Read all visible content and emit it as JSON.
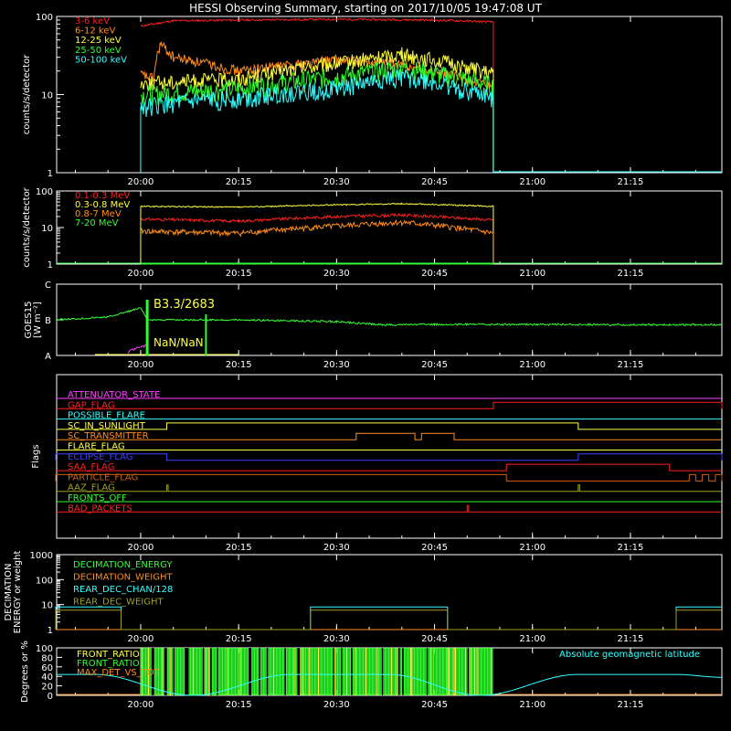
{
  "title": "HESSI Observing Summary, starting on 2017/10/05 19:47:08 UT",
  "time_ticks": [
    "20:00",
    "20:15",
    "20:30",
    "20:45",
    "21:00",
    "21:15"
  ],
  "colors": {
    "red": "#ff2020",
    "orange": "#ff8c1a",
    "yellow": "#ffff40",
    "green": "#30ff30",
    "cyan": "#30ffff",
    "magenta": "#ff40ff",
    "blue": "#4040ff",
    "brown": "#d06010",
    "olive": "#a0a020",
    "white": "#ffffff"
  },
  "chart_data": [
    {
      "type": "line",
      "panel": "lightcurve-front",
      "ylabel": "counts/s/detector",
      "yscale": "log",
      "ylim": [
        1,
        100
      ],
      "y_ticks": [
        "1",
        "10",
        "100"
      ],
      "xlim": [
        "19:47:08",
        "21:29:00"
      ],
      "legend_placement": "top-left",
      "series": [
        {
          "name": "3-6 keV",
          "color": "red",
          "x": [
            "20:00",
            "20:05",
            "20:15",
            "20:30",
            "20:45",
            "20:54",
            "20:54"
          ],
          "y": [
            75,
            88,
            90,
            92,
            90,
            85,
            1
          ]
        },
        {
          "name": "6-12 keV",
          "color": "orange",
          "x": [
            "20:00",
            "20:02",
            "20:03",
            "20:05",
            "20:15",
            "20:30",
            "20:40",
            "20:54",
            "20:54"
          ],
          "y": [
            18,
            16,
            44,
            30,
            20,
            28,
            24,
            12,
            1
          ]
        },
        {
          "name": "12-25 keV",
          "color": "yellow",
          "x": [
            "20:00",
            "20:15",
            "20:30",
            "20:40",
            "20:54",
            "20:54"
          ],
          "y": [
            14,
            16,
            25,
            33,
            18,
            1
          ]
        },
        {
          "name": "25-50 keV",
          "color": "green",
          "x": [
            "20:00",
            "20:15",
            "20:30",
            "20:40",
            "20:54",
            "20:54"
          ],
          "y": [
            10,
            12,
            17,
            22,
            13,
            1
          ]
        },
        {
          "name": "50-100 keV",
          "color": "cyan",
          "x": [
            "20:00",
            "20:15",
            "20:30",
            "20:40",
            "20:54",
            "20:54"
          ],
          "y": [
            7,
            9,
            12,
            17,
            9,
            1
          ]
        }
      ]
    },
    {
      "type": "line",
      "panel": "lightcurve-rear",
      "ylabel": "counts/s/detector",
      "yscale": "log",
      "ylim": [
        1,
        100
      ],
      "y_ticks": [
        "1",
        "10",
        "100"
      ],
      "xlim": [
        "19:47:08",
        "21:29:00"
      ],
      "legend_placement": "top-left",
      "series": [
        {
          "name": "0.1-0.3 MeV",
          "color": "red",
          "x": [
            "20:00",
            "20:15",
            "20:30",
            "20:40",
            "20:54",
            "20:54"
          ],
          "y": [
            17,
            15,
            20,
            22,
            16,
            1
          ]
        },
        {
          "name": "0.3-0.8 MeV",
          "color": "yellow",
          "x": [
            "20:00",
            "20:15",
            "20:30",
            "20:40",
            "20:54",
            "20:54"
          ],
          "y": [
            38,
            36,
            42,
            45,
            38,
            1
          ]
        },
        {
          "name": "0.8-7 MeV",
          "color": "orange",
          "x": [
            "20:00",
            "20:15",
            "20:30",
            "20:40",
            "20:54",
            "20:54"
          ],
          "y": [
            8,
            7,
            11,
            14,
            7,
            1
          ]
        },
        {
          "name": "7-20 MeV",
          "color": "green",
          "x": [
            "20:00",
            "20:54"
          ],
          "y": [
            1,
            1
          ]
        }
      ]
    },
    {
      "type": "line",
      "panel": "goes",
      "ylabel": "GOES15",
      "ylabel_units": "[W m⁻²]",
      "y_ticks": [
        "A",
        "B",
        "C"
      ],
      "ylim_class": [
        "A",
        "C"
      ],
      "xlim": [
        "19:47:08",
        "21:29:00"
      ],
      "annotations": [
        "B3.3/2683",
        "NaN/NaN"
      ],
      "series": [
        {
          "name": "GOES long",
          "color": "green",
          "x": [
            "19:47",
            "19:55",
            "20:00",
            "20:01",
            "20:15",
            "20:30",
            "20:37",
            "20:45",
            "21:00",
            "21:15",
            "21:29"
          ],
          "y": [
            1.0,
            1.08,
            1.33,
            1.0,
            1.0,
            0.95,
            0.86,
            0.87,
            0.87,
            0.86,
            0.86
          ]
        },
        {
          "name": "GOES short",
          "color": "magenta",
          "x": [
            "19:58",
            "20:00",
            "20:01"
          ],
          "y": [
            0.1,
            0.28,
            0.3
          ]
        }
      ]
    },
    {
      "type": "line",
      "panel": "flags",
      "ylabel": "Flags",
      "flags": [
        {
          "name": "ATTENUATOR_STATE",
          "color": "magenta",
          "on": []
        },
        {
          "name": "GAP_FLAG",
          "color": "red",
          "on": [
            [
              "20:54",
              "21:29"
            ]
          ]
        },
        {
          "name": "POSSIBLE_FLARE",
          "color": "cyan",
          "on": []
        },
        {
          "name": "SC_IN_SUNLIGHT",
          "color": "yellow",
          "on": [
            [
              "20:04",
              "21:07"
            ]
          ]
        },
        {
          "name": "SC_TRANSMITTER",
          "color": "orange",
          "on": [
            [
              "20:33",
              "20:42"
            ],
            [
              "20:43",
              "20:48"
            ]
          ]
        },
        {
          "name": "FLARE_FLAG",
          "color": "yellow",
          "on": []
        },
        {
          "name": "ECLIPSE_FLAG",
          "color": "blue",
          "on": [
            [
              "19:47",
              "20:04"
            ],
            [
              "21:07",
              "21:29"
            ]
          ]
        },
        {
          "name": "SAA_FLAG",
          "color": "red",
          "on": [
            [
              "20:56",
              "21:21"
            ]
          ]
        },
        {
          "name": "PARTICLE_FLAG",
          "color": "brown",
          "on": [
            [
              "19:47",
              "20:56"
            ],
            [
              "21:24",
              "21:25"
            ],
            [
              "21:26",
              "21:27"
            ],
            [
              "21:28",
              "21:29"
            ]
          ]
        },
        {
          "name": "AAZ_FLAG",
          "color": "olive",
          "on": [
            [
              "20:04",
              "20:04"
            ],
            [
              "21:07",
              "21:07"
            ]
          ]
        },
        {
          "name": "FRONTS_OFF",
          "color": "green",
          "on": []
        },
        {
          "name": "BAD_PACKETS",
          "color": "red",
          "on": [
            [
              "20:50",
              "20:50"
            ]
          ]
        }
      ]
    },
    {
      "type": "line",
      "panel": "decimation",
      "ylabel": "DECIMATION ENERGY or weight",
      "yscale": "log",
      "ylim": [
        1,
        1000
      ],
      "y_ticks": [
        "1",
        "10",
        "100",
        "1000"
      ],
      "xlim": [
        "19:47:08",
        "21:29:00"
      ],
      "legend_placement": "top-left",
      "series": [
        {
          "name": "DECIMATION_ENERGY",
          "color": "green",
          "x": [
            "19:47",
            "21:29"
          ],
          "y": [
            1,
            1
          ]
        },
        {
          "name": "DECIMATION_WEIGHT",
          "color": "orange",
          "x": [
            "19:47",
            "21:29"
          ],
          "y": [
            1,
            1
          ]
        },
        {
          "name": "REAR_DEC_CHAN/128",
          "color": "cyan",
          "x": [
            "19:47",
            "19:47",
            "19:57",
            "19:57",
            "20:26",
            "20:26",
            "20:47",
            "20:47",
            "21:22",
            "21:22",
            "21:29"
          ],
          "y": [
            1,
            8,
            8,
            1,
            1,
            8,
            8,
            1,
            1,
            8,
            8
          ]
        },
        {
          "name": "REAR_DEC_WEIGHT",
          "color": "olive",
          "x": [
            "19:47",
            "19:47",
            "19:57",
            "19:57",
            "20:26",
            "20:26",
            "20:47",
            "20:47",
            "21:22",
            "21:22",
            "21:29"
          ],
          "y": [
            1,
            6,
            6,
            1,
            1,
            6,
            6,
            1,
            1,
            6,
            6
          ]
        }
      ]
    },
    {
      "type": "line",
      "panel": "ratios",
      "ylabel": "Degrees or %",
      "ylim": [
        0,
        100
      ],
      "y_ticks": [
        "0",
        "20",
        "40",
        "60",
        "80",
        "100"
      ],
      "xlim": [
        "19:47:08",
        "21:29:00"
      ],
      "legend_placement": "top-left",
      "annotation": "Absolute geomagnetic latitude",
      "series": [
        {
          "name": "FRONT_RATIO",
          "color": "yellow",
          "x": [
            "20:00",
            "20:54"
          ],
          "y": [
            100,
            100
          ]
        },
        {
          "name": "FRONT_RATIO",
          "color": "green",
          "x": [
            "20:00",
            "20:54"
          ],
          "y": [
            100,
            100
          ]
        },
        {
          "name": "MAX_DET_VS_TOT",
          "color": "orange",
          "x": [
            "20:00",
            "20:54"
          ],
          "y": [
            100,
            100
          ]
        },
        {
          "name": "Absolute geomagnetic latitude",
          "color": "cyan",
          "x": [
            "19:47",
            "19:53",
            "20:08",
            "20:23",
            "20:38",
            "20:52",
            "21:07",
            "21:22",
            "21:29"
          ],
          "y": [
            44,
            44,
            0,
            44,
            44,
            0,
            44,
            44,
            38
          ]
        }
      ]
    }
  ]
}
